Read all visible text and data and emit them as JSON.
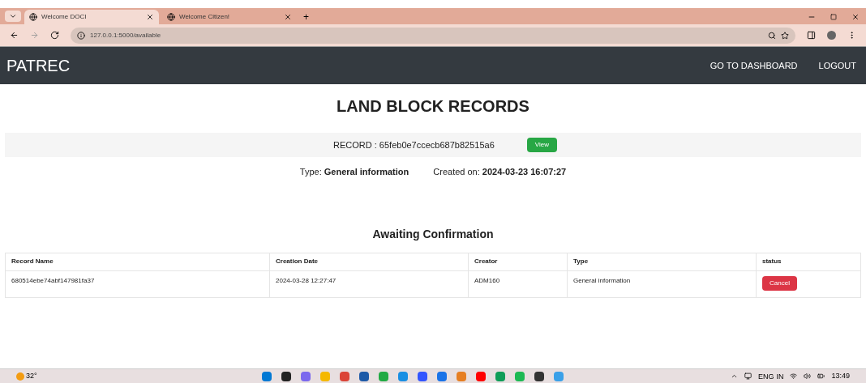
{
  "browser": {
    "tabs": [
      {
        "title": "Welcome DOCI",
        "selected": true
      },
      {
        "title": "Welcome Citizen!",
        "selected": false
      }
    ],
    "new_tab": "+",
    "address": "127.0.0.1:5000/available"
  },
  "navbar": {
    "brand": "PATREC",
    "links": [
      "GO TO DASHBOARD",
      "LOGOUT"
    ]
  },
  "page_title": "LAND BLOCK RECORDS",
  "record": {
    "label": "RECORD : 65feb0e7ccecb687b82515a6",
    "button": "View",
    "type_label": "Type:",
    "type_value": "General information",
    "created_label": "Created on:",
    "created_value": "2024-03-23 16:07:27"
  },
  "awaiting": {
    "title": "Awaiting Confirmation",
    "columns": [
      "Record Name",
      "Creation Date",
      "Creator",
      "Type",
      "status"
    ],
    "rows": [
      {
        "cells": [
          "680514ebe74abf147981fa37",
          "2024-03-28 12:27:47",
          "ADM160",
          "General information"
        ],
        "action": "Cancel"
      }
    ]
  },
  "taskbar": {
    "weather": "32°",
    "tray_lang": [
      "ENG",
      "IN"
    ],
    "time": "13:49"
  }
}
